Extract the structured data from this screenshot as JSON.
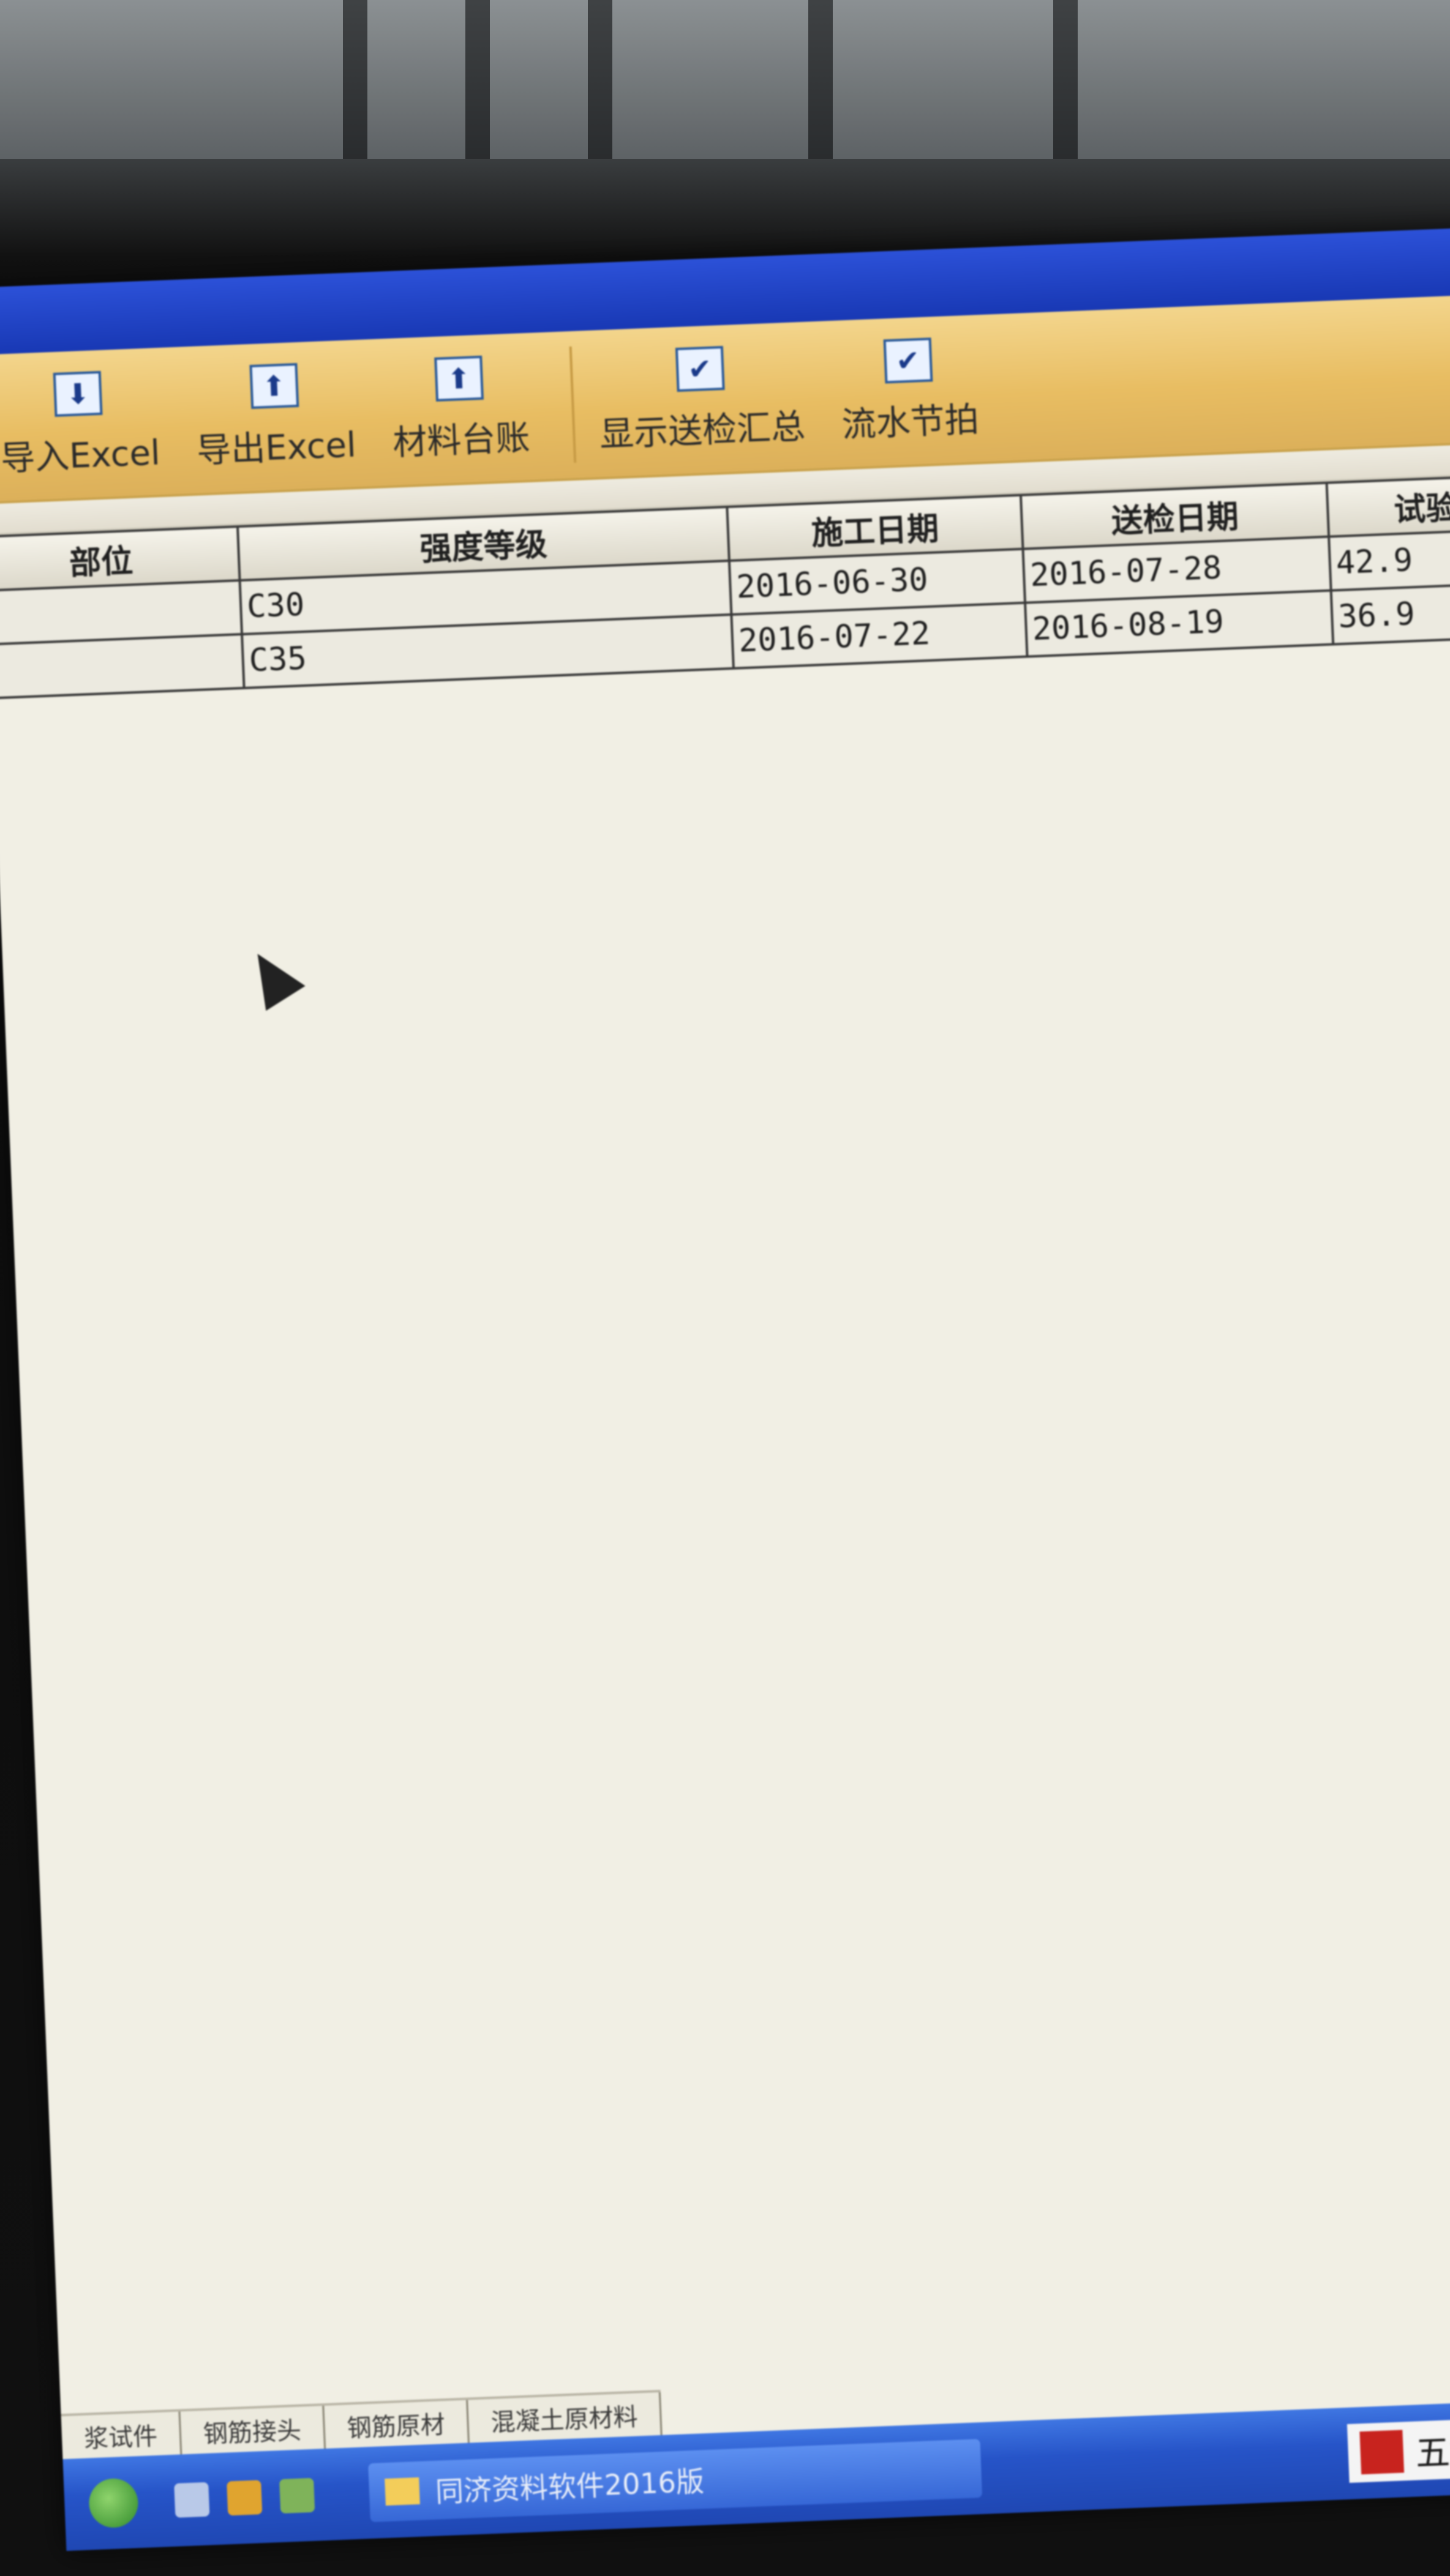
{
  "toolbar": {
    "items": [
      {
        "label": "导入Excel",
        "icon": "import-excel-icon"
      },
      {
        "label": "导出Excel",
        "icon": "export-excel-icon"
      },
      {
        "label": "材料台账",
        "icon": "ledger-icon"
      },
      {
        "label": "显示送检汇总",
        "icon": "check-icon"
      },
      {
        "label": "流水节拍",
        "icon": "check-icon"
      }
    ]
  },
  "table": {
    "headers": [
      "部位",
      "强度等级",
      "施工日期",
      "送检日期",
      "试验"
    ],
    "rows": [
      {
        "part": "",
        "grade": "C30",
        "build_date": "2016-06-30",
        "send_date": "2016-07-28",
        "value": "42.9"
      },
      {
        "part": "",
        "grade": "C35",
        "build_date": "2016-07-22",
        "send_date": "2016-08-19",
        "value": "36.9"
      }
    ]
  },
  "sheet_tabs": [
    "浆试件",
    "钢筋接头",
    "钢筋原材",
    "混凝土原材料"
  ],
  "taskbar": {
    "window_title": "同济资料软件2016版",
    "ime_label": "五笔"
  },
  "colors": {
    "titlebar": "#1f45c8",
    "toolbar": "#e8bd62",
    "grid_background": "#f1efe4",
    "taskbar": "#2654c8"
  }
}
